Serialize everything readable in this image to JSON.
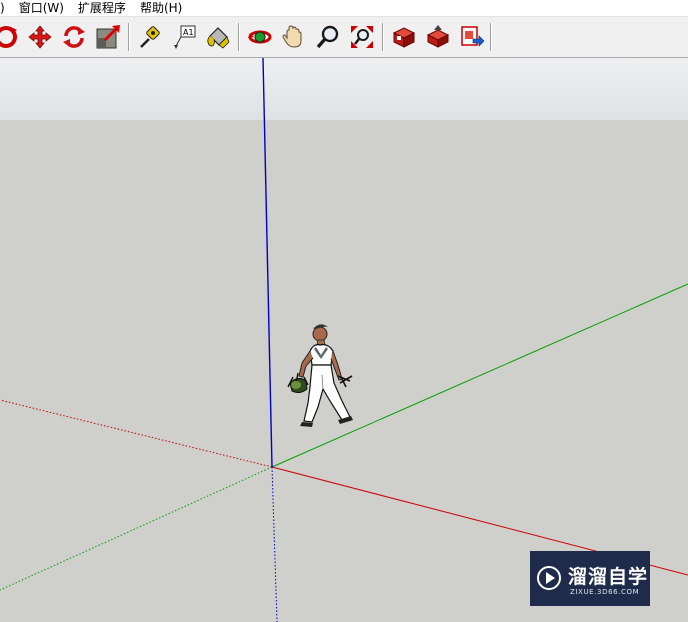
{
  "menu": [
    ")",
    "窗口(W)",
    "扩展程序",
    "帮助(H)"
  ],
  "toolbar": {
    "groups": [
      [
        "orbit-icon",
        "move-icon",
        "rotate-icon",
        "scale-icon"
      ],
      [
        "tape-measure-icon",
        "text-label-icon",
        "paint-bucket-icon"
      ],
      [
        "orbit-camera-icon",
        "pan-icon",
        "zoom-icon",
        "zoom-extents-icon"
      ],
      [
        "warehouse-icon",
        "share-model-icon",
        "export-icon"
      ]
    ],
    "text_tool_glyph": "A1"
  },
  "axes": {
    "red": "#cc0000",
    "green": "#00a000",
    "blue": "#0000cc"
  },
  "watermark": {
    "title": "溜溜自学",
    "subtitle": "ZIXUE.3D66.COM"
  }
}
